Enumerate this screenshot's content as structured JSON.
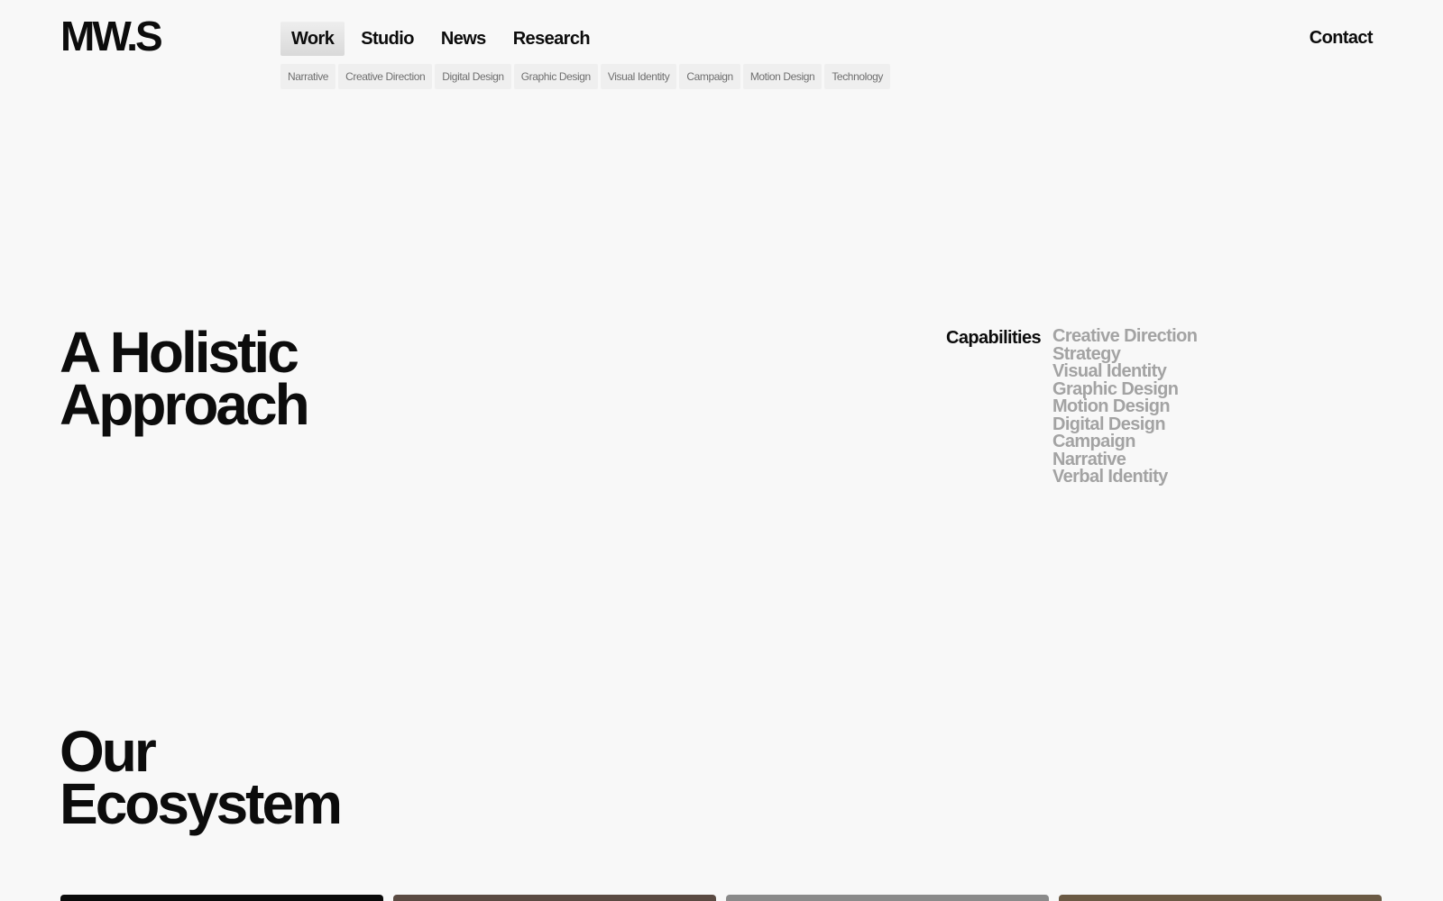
{
  "header": {
    "logo": "MW.S",
    "nav": [
      {
        "label": "Work",
        "active": true
      },
      {
        "label": "Studio",
        "active": false
      },
      {
        "label": "News",
        "active": false
      },
      {
        "label": "Research",
        "active": false
      }
    ],
    "contact": "Contact"
  },
  "sub_nav": [
    "Narrative",
    "Creative Direction",
    "Digital Design",
    "Graphic Design",
    "Visual Identity",
    "Campaign",
    "Motion Design",
    "Technology"
  ],
  "holistic": {
    "title_line1": "A Holistic",
    "title_line2": "Approach",
    "capabilities_label": "Capabilities",
    "capabilities": [
      "Creative Direction",
      "Strategy",
      "Visual Identity",
      "Graphic Design",
      "Motion Design",
      "Digital Design",
      "Campaign",
      "Narrative",
      "Verbal Identity"
    ]
  },
  "ecosystem": {
    "title_line1": "Our",
    "title_line2": "Ecosystem",
    "card_colors": [
      "#0a0a0a",
      "#5a4a42",
      "#8a8a8a",
      "#6b5a44"
    ]
  }
}
